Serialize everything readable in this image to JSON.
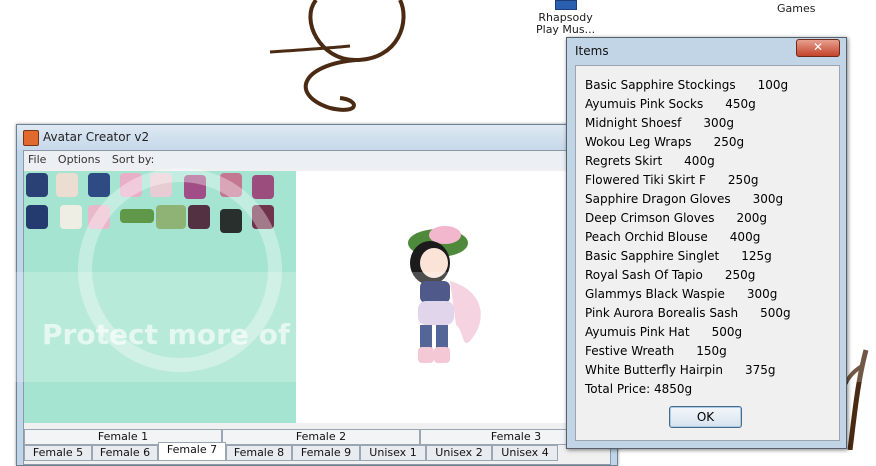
{
  "desktop": {
    "icon1_label_line1": "Rhapsody",
    "icon1_label_line2": "Play Mus...",
    "icon2_label": "Games"
  },
  "main_window": {
    "title": "Avatar Creator v2",
    "menu": [
      "File",
      "Options",
      "Sort by:"
    ],
    "tabs_row1": [
      "Female 1",
      "Female 2",
      "Female 3"
    ],
    "tabs_row2": [
      "Female 5",
      "Female 6",
      "Female 7",
      "Female 8",
      "Female 9",
      "Unisex 1",
      "Unisex 2",
      "Unisex 4"
    ],
    "active_tab": "Female 7"
  },
  "watermark": {
    "text": "Protect more of your memories for less!",
    "visible_text": "Protect more of y"
  },
  "items_dialog": {
    "title": "Items",
    "close_icon": "✕",
    "items": [
      {
        "name": "Basic Sapphire Stockings",
        "price": "100g"
      },
      {
        "name": "Ayumuis Pink Socks",
        "price": "450g"
      },
      {
        "name": "Midnight Shoesf",
        "price": "300g"
      },
      {
        "name": "Wokou Leg Wraps",
        "price": "250g"
      },
      {
        "name": "Regrets Skirt",
        "price": "400g"
      },
      {
        "name": "Flowered Tiki Skirt F",
        "price": "250g"
      },
      {
        "name": "Sapphire Dragon Gloves",
        "price": "300g"
      },
      {
        "name": "Deep Crimson Gloves",
        "price": "200g"
      },
      {
        "name": "Peach Orchid Blouse",
        "price": "400g"
      },
      {
        "name": "Basic Sapphire Singlet",
        "price": "125g"
      },
      {
        "name": "Royal Sash Of Tapio",
        "price": "250g"
      },
      {
        "name": "Glammys Black Waspie",
        "price": "300g"
      },
      {
        "name": "Pink Aurora Borealis Sash",
        "price": "500g"
      },
      {
        "name": "Ayumuis Pink Hat",
        "price": "500g"
      },
      {
        "name": "Festive Wreath",
        "price": "150g"
      },
      {
        "name": "White Butterfly Hairpin",
        "price": "375g"
      }
    ],
    "total_label": "Total Price: 4850g",
    "ok_label": "OK"
  },
  "colors": {
    "palette_bg": "#a4e4d0",
    "scribble": "#4a2a12",
    "window_frame": "#bfd6ea",
    "close_button": "#c2432a"
  }
}
